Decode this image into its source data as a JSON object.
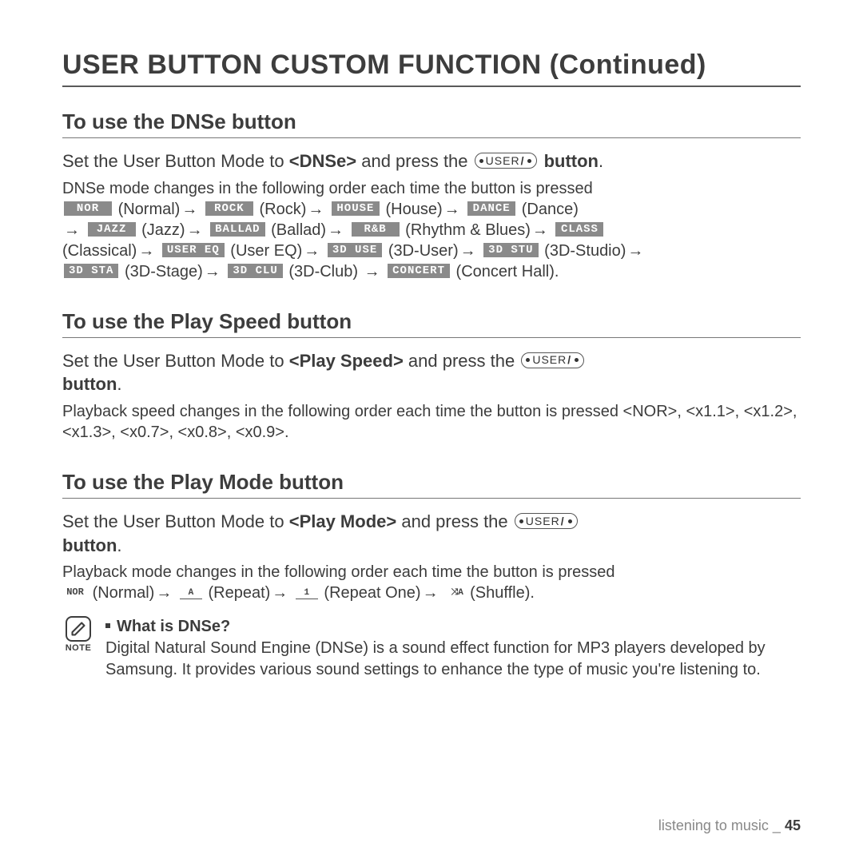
{
  "title": "USER BUTTON CUSTOM FUNCTION (Continued)",
  "user_button_label": "USER",
  "sections": {
    "dnse": {
      "heading": "To use the DNSe button",
      "lead_pre": "Set the User Button Mode to ",
      "lead_mode": "<DNSe>",
      "lead_mid": " and press the ",
      "lead_post": " button",
      "body_intro": "DNSe mode changes in the following order each time the button is pressed",
      "items": [
        {
          "lcd": "NOR",
          "label": "(Normal)"
        },
        {
          "lcd": "ROCK",
          "label": "(Rock)"
        },
        {
          "lcd": "HOUSE",
          "label": "(House)"
        },
        {
          "lcd": "DANCE",
          "label": "(Dance)"
        },
        {
          "lcd": "JAZZ",
          "label": "(Jazz)"
        },
        {
          "lcd": "BALLAD",
          "label": "(Ballad)"
        },
        {
          "lcd": "R&B",
          "label": "(Rhythm & Blues)"
        },
        {
          "lcd": "CLASS",
          "label": "(Classical)"
        },
        {
          "lcd": "USER EQ",
          "label": "(User EQ)"
        },
        {
          "lcd": "3D USE",
          "label": "(3D-User)"
        },
        {
          "lcd": "3D STU",
          "label": "(3D-Studio)"
        },
        {
          "lcd": "3D STA",
          "label": "(3D-Stage)"
        },
        {
          "lcd": "3D CLU",
          "label": "(3D-Club)"
        },
        {
          "lcd": "CONCERT",
          "label": "(Concert Hall)"
        }
      ]
    },
    "speed": {
      "heading": "To use the Play Speed button",
      "lead_pre": "Set the User Button Mode to ",
      "lead_mode": "<Play Speed>",
      "lead_mid": " and press the ",
      "lead_post": " button",
      "body": "Playback speed changes in the following order each time the button is pressed <NOR>, <x1.1>, <x1.2>, <x1.3>, <x0.7>, <x0.8>, <x0.9>."
    },
    "mode": {
      "heading": "To use the Play Mode button",
      "lead_pre": "Set the User Button Mode to ",
      "lead_mode": "<Play Mode>",
      "lead_mid": " and press the ",
      "lead_post": " button",
      "body_intro": "Playback mode changes in the following order each time the button is pressed",
      "items": [
        {
          "icon": "NOR",
          "label": "(Normal)"
        },
        {
          "icon": "A",
          "label": "(Repeat)"
        },
        {
          "icon": "1",
          "label": "(Repeat One)"
        },
        {
          "icon": "⤨A",
          "label": "(Shuffle)"
        }
      ]
    }
  },
  "note": {
    "label": "NOTE",
    "title": "What is DNSe?",
    "body": "Digital Natural Sound Engine (DNSe) is a sound effect function for MP3 players developed by Samsung. It provides various sound settings to enhance the type of music you're listening to."
  },
  "footer": {
    "section": "listening to music _",
    "page": "45"
  },
  "arrow": "→"
}
